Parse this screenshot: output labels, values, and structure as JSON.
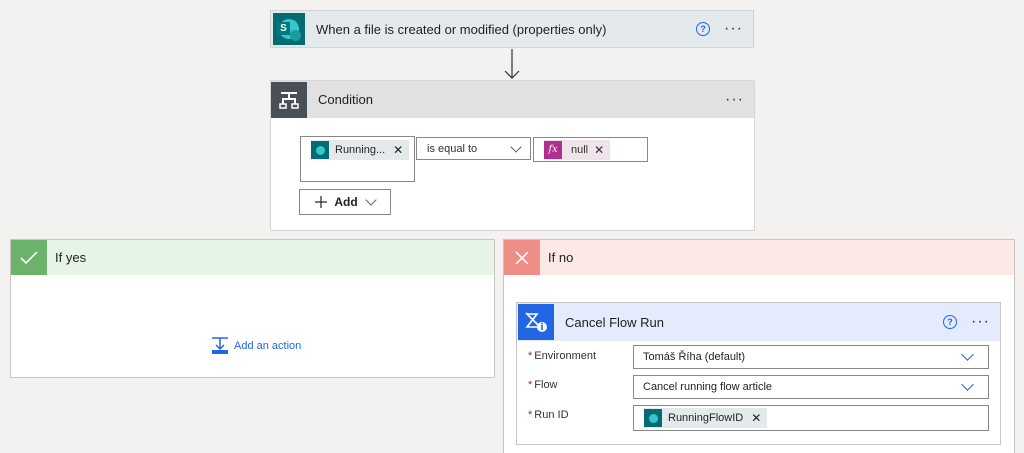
{
  "trigger": {
    "title": "When a file is created or modified (properties only)",
    "help": "?",
    "more": "···"
  },
  "condition": {
    "title": "Condition",
    "more": "···",
    "left_token": "Running...",
    "operator": "is equal to",
    "right_token": "null",
    "add_label": "Add",
    "remove_glyph": "✕"
  },
  "if_yes": {
    "title": "If yes",
    "add_action": "Add an action"
  },
  "if_no": {
    "title": "If no"
  },
  "cancel_flow_run": {
    "title": "Cancel Flow Run",
    "help": "?",
    "more": "···",
    "fields": [
      {
        "label": "Environment",
        "value": "Tomáš Říha (default)",
        "required": "*"
      },
      {
        "label": "Flow",
        "value": "Cancel running flow article",
        "required": "*"
      },
      {
        "label": "Run ID",
        "value": "RunningFlowID",
        "required": "*"
      }
    ]
  },
  "colors": {
    "accent": "#2266e3",
    "yes": "#e6f4e6",
    "yes_icon": "#6bb26b",
    "no": "#fce9e7",
    "no_icon": "#ef8e86",
    "sharepoint": "#036c70",
    "expression": "#ae2f8e"
  },
  "icons": [
    "sharepoint-icon",
    "condition-icon",
    "check-icon",
    "close-icon",
    "fx-icon",
    "add-action-icon",
    "cancel-flow-icon",
    "help-icon",
    "chevron-down-icon"
  ]
}
